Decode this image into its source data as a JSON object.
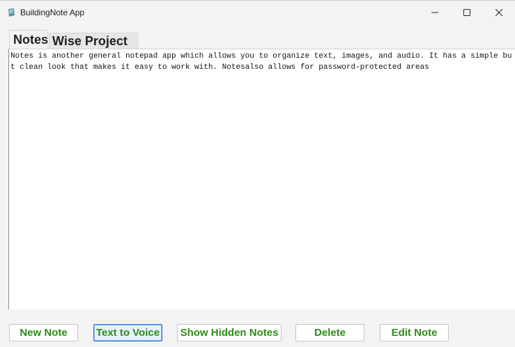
{
  "window": {
    "title": "BuildingNote App",
    "minimize_icon": "minimize-icon",
    "maximize_icon": "maximize-icon",
    "close_icon": "close-icon"
  },
  "tabs": [
    {
      "label": "Notes",
      "selected": true
    },
    {
      "label": "Wise Project",
      "selected": false
    }
  ],
  "editor": {
    "content": "Notes is another general notepad app which allows you to organize text, images, and audio. It has a simple but clean look that makes it easy to work with. Notesalso allows for password-protected areas"
  },
  "buttons": {
    "new_note": "New Note",
    "text_to_voice": "Text to Voice",
    "show_hidden_notes": "Show Hidden Notes",
    "delete": "Delete",
    "edit_note": "Edit Note"
  },
  "colors": {
    "button_text": "#2e8b1a",
    "focused_border": "#2f6fd0"
  }
}
